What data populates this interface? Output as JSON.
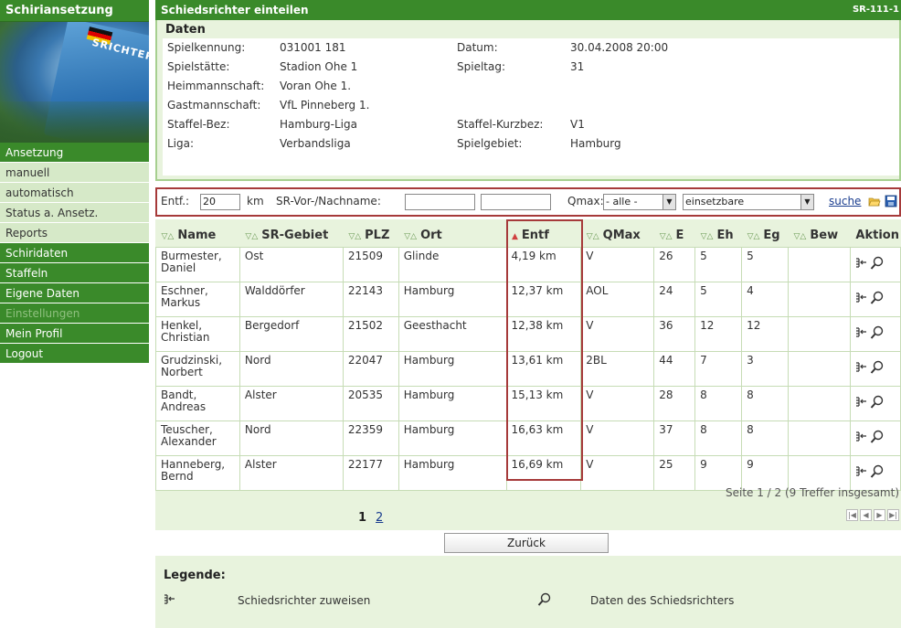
{
  "sidebar": {
    "title": "Schiriansetzung",
    "image_text": "SRICHTER",
    "items": [
      {
        "label": "Ansetzung",
        "kind": "head"
      },
      {
        "label": "manuell",
        "kind": "sub"
      },
      {
        "label": "automatisch",
        "kind": "sub"
      },
      {
        "label": "Status a. Ansetz.",
        "kind": "sub"
      },
      {
        "label": "Reports",
        "kind": "sub"
      },
      {
        "label": "Schiridaten",
        "kind": "main"
      },
      {
        "label": "Staffeln",
        "kind": "main"
      },
      {
        "label": "Eigene Daten",
        "kind": "main"
      },
      {
        "label": "Einstellungen",
        "kind": "disabled"
      },
      {
        "label": "Mein Profil",
        "kind": "main"
      },
      {
        "label": "Logout",
        "kind": "main"
      }
    ]
  },
  "header": {
    "title": "Schiedsrichter einteilen",
    "code": "SR-111-1"
  },
  "daten": {
    "title": "Daten",
    "spielkennung_label": "Spielkennung:",
    "spielkennung": "031001 181",
    "spielstaette_label": "Spielstätte:",
    "spielstaette": "Stadion Ohe 1",
    "heim_label": "Heimmannschaft:",
    "heim": "Voran Ohe 1.",
    "gast_label": "Gastmannschaft:",
    "gast": "VfL Pinneberg 1.",
    "staffel_bez_label": "Staffel-Bez:",
    "staffel_bez": "Hamburg-Liga",
    "liga_label": "Liga:",
    "liga": "Verbandsliga",
    "datum_label": "Datum:",
    "datum": "30.04.2008 20:00",
    "spieltag_label": "Spieltag:",
    "spieltag": "31",
    "staffel_kurz_label": "Staffel-Kurzbez:",
    "staffel_kurz": "V1",
    "spielgebiet_label": "Spielgebiet:",
    "spielgebiet": "Hamburg"
  },
  "filter": {
    "entf_label": "Entf.:",
    "entf_value": "20",
    "km_label": "km",
    "name_label": "SR-Vor-/Nachname:",
    "vorname_value": "",
    "nachname_value": "",
    "qmax_label": "Qmax:",
    "qmax_value": "- alle -",
    "status_value": "einsetzbare",
    "search_link": "suche"
  },
  "table": {
    "columns": [
      "Name",
      "SR-Gebiet",
      "PLZ",
      "Ort",
      "Entf",
      "QMax",
      "E",
      "Eh",
      "Eg",
      "Bew",
      "Aktion"
    ],
    "rows": [
      {
        "name1": "Burmester,",
        "name2": "Daniel",
        "gebiet": "Ost",
        "plz": "21509",
        "ort": "Glinde",
        "entf": "4,19 km",
        "qmax": "V",
        "e": "26",
        "eh": "5",
        "eg": "5",
        "bew": ""
      },
      {
        "name1": "Eschner,",
        "name2": "Markus",
        "gebiet": "Walddörfer",
        "plz": "22143",
        "ort": "Hamburg",
        "entf": "12,37 km",
        "qmax": "AOL",
        "e": "24",
        "eh": "5",
        "eg": "4",
        "bew": ""
      },
      {
        "name1": "Henkel,",
        "name2": "Christian",
        "gebiet": "Bergedorf",
        "plz": "21502",
        "ort": "Geesthacht",
        "entf": "12,38 km",
        "qmax": "V",
        "e": "36",
        "eh": "12",
        "eg": "12",
        "bew": ""
      },
      {
        "name1": "Grudzinski,",
        "name2": "Norbert",
        "gebiet": "Nord",
        "plz": "22047",
        "ort": "Hamburg",
        "entf": "13,61 km",
        "qmax": "2BL",
        "e": "44",
        "eh": "7",
        "eg": "3",
        "bew": ""
      },
      {
        "name1": "Bandt,",
        "name2": "Andreas",
        "gebiet": "Alster",
        "plz": "20535",
        "ort": "Hamburg",
        "entf": "15,13 km",
        "qmax": "V",
        "e": "28",
        "eh": "8",
        "eg": "8",
        "bew": ""
      },
      {
        "name1": "Teuscher,",
        "name2": "Alexander",
        "gebiet": "Nord",
        "plz": "22359",
        "ort": "Hamburg",
        "entf": "16,63 km",
        "qmax": "V",
        "e": "37",
        "eh": "8",
        "eg": "8",
        "bew": ""
      },
      {
        "name1": "Hanneberg,",
        "name2": "Bernd",
        "gebiet": "Alster",
        "plz": "22177",
        "ort": "Hamburg",
        "entf": "16,69 km",
        "qmax": "V",
        "e": "25",
        "eh": "9",
        "eg": "9",
        "bew": ""
      }
    ]
  },
  "pager": {
    "info": "Seite 1 / 2 (9 Treffer insgesamt)",
    "current": "1",
    "next": "2"
  },
  "back_button": "Zurück",
  "legend": {
    "title": "Legende:",
    "assign": "Schiedsrichter zuweisen",
    "details": "Daten des Schiedsrichters"
  },
  "colors": {
    "green": "#3a8a2a",
    "light_green": "#e8f3dd",
    "highlight_red": "#a63a3a"
  }
}
